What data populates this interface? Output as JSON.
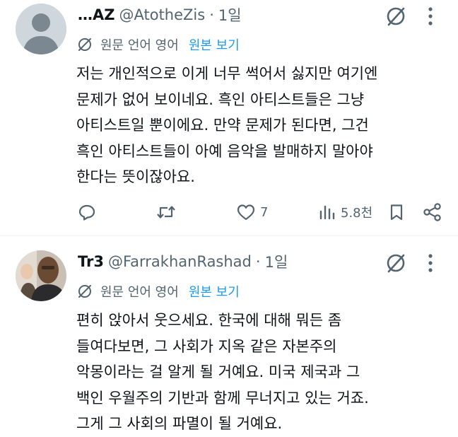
{
  "tweets": [
    {
      "name": "…AZ",
      "handle": "@AtotheZis",
      "dot": "·",
      "time": "1일",
      "translate_label": "원문 언어 영어",
      "translate_link": "원본 보기",
      "lines": [
        "저는 개인적으로 이게 너무 썩어서 싫지만 여기엔",
        "문제가 없어 보이네요. 흑인 아티스트들은 그냥",
        "아티스트일 뿐이에요. 만약 문제가 된다면, 그건",
        "흑인 아티스트들이 아예 음악을 발매하지 말아야",
        "한다는 뜻이잖아요."
      ],
      "stats": {
        "likes": "7",
        "views": "5.8천"
      }
    },
    {
      "name": "Tr3",
      "handle": "@FarrakhanRashad",
      "dot": "·",
      "time": "1일",
      "translate_label": "원문 언어 영어",
      "translate_link": "원본 보기",
      "lines": [
        "편히 앉아서 웃으세요. 한국에 대해 뭐든 좀",
        "들여다보면, 그 사회가 지옥 같은 자본주의",
        "악몽이라는 걸 알게 될 거예요. 미국 제국과 그",
        "백인 우월주의 기반과 함께 무너지고 있는 거죠.",
        "그게 그 사회의 파멸이 될 거예요."
      ]
    }
  ],
  "icons": [
    "default-avatar",
    "grok-icon",
    "more-icon",
    "translate-icon",
    "reply-icon",
    "retweet-icon",
    "like-icon",
    "views-icon",
    "bookmark-icon",
    "share-icon"
  ],
  "colors": {
    "text": "#0f1419",
    "secondary": "#536471",
    "link": "#1d9bf0",
    "divider": "#eff3f4"
  }
}
